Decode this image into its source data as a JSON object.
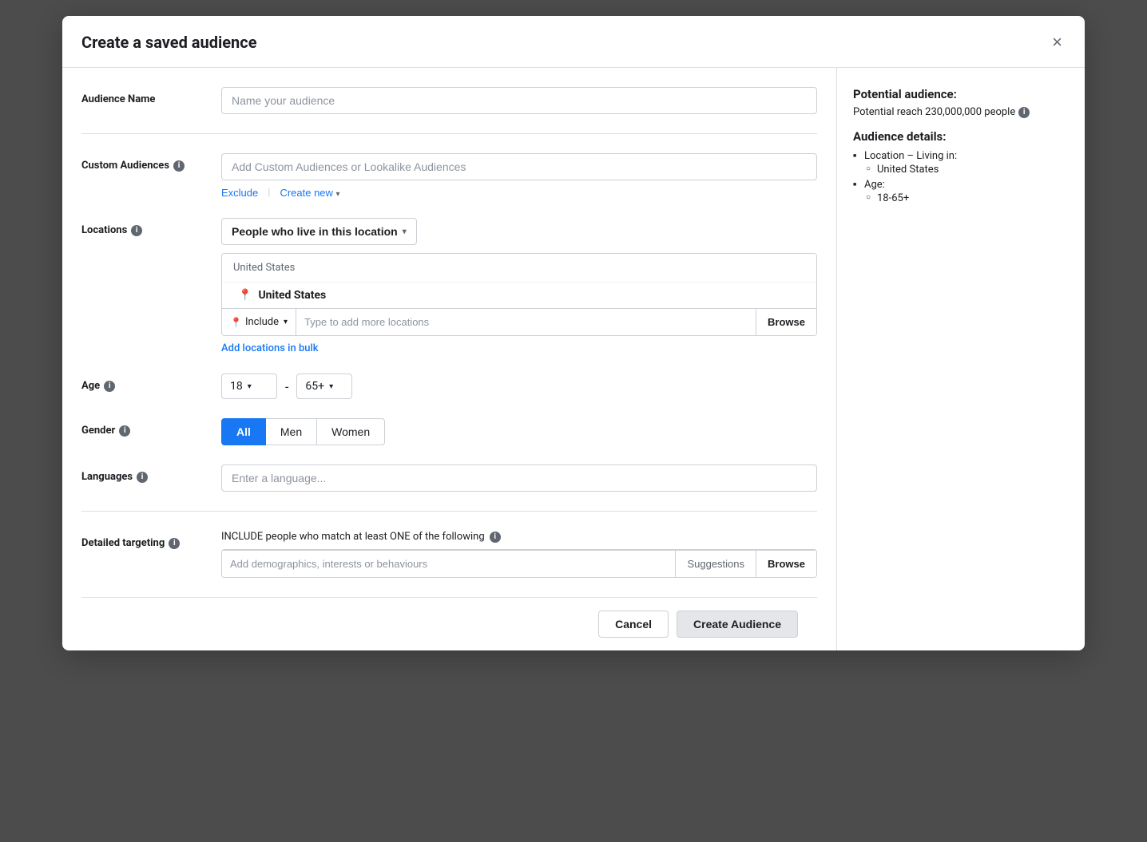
{
  "modal": {
    "title": "Create a saved audience",
    "close_label": "×"
  },
  "form": {
    "audience_name": {
      "label": "Audience Name",
      "placeholder": "Name your audience",
      "value": ""
    },
    "custom_audiences": {
      "label": "Custom Audiences",
      "placeholder": "Add Custom Audiences or Lookalike Audiences",
      "exclude_label": "Exclude",
      "create_new_label": "Create new"
    },
    "locations": {
      "label": "Locations",
      "filter_label": "People who live in this location",
      "location_header": "United States",
      "location_item": "United States",
      "include_label": "Include",
      "location_search_placeholder": "Type to add more locations",
      "browse_label": "Browse",
      "add_bulk_label": "Add locations in bulk"
    },
    "age": {
      "label": "Age",
      "min": "18",
      "separator": "-",
      "max": "65+"
    },
    "gender": {
      "label": "Gender",
      "options": [
        {
          "label": "All",
          "active": true
        },
        {
          "label": "Men",
          "active": false
        },
        {
          "label": "Women",
          "active": false
        }
      ]
    },
    "languages": {
      "label": "Languages",
      "placeholder": "Enter a language..."
    },
    "detailed_targeting": {
      "label": "Detailed targeting",
      "description": "INCLUDE people who match at least ONE of the following",
      "search_placeholder": "Add demographics, interests or behaviours",
      "suggestions_label": "Suggestions",
      "browse_label": "Browse"
    }
  },
  "sidebar": {
    "potential_audience_title": "Potential audience:",
    "reach_text": "Potential reach 230,000,000 people",
    "details_title": "Audience details:",
    "details": [
      {
        "label": "Location – Living in:",
        "sub_items": [
          "United States"
        ]
      },
      {
        "label": "Age:",
        "sub_items": [
          "18-65+"
        ]
      }
    ]
  },
  "footer": {
    "cancel_label": "Cancel",
    "create_label": "Create Audience"
  },
  "icons": {
    "info": "i",
    "close": "✕",
    "chevron_down": "▼",
    "pin": "📍"
  }
}
